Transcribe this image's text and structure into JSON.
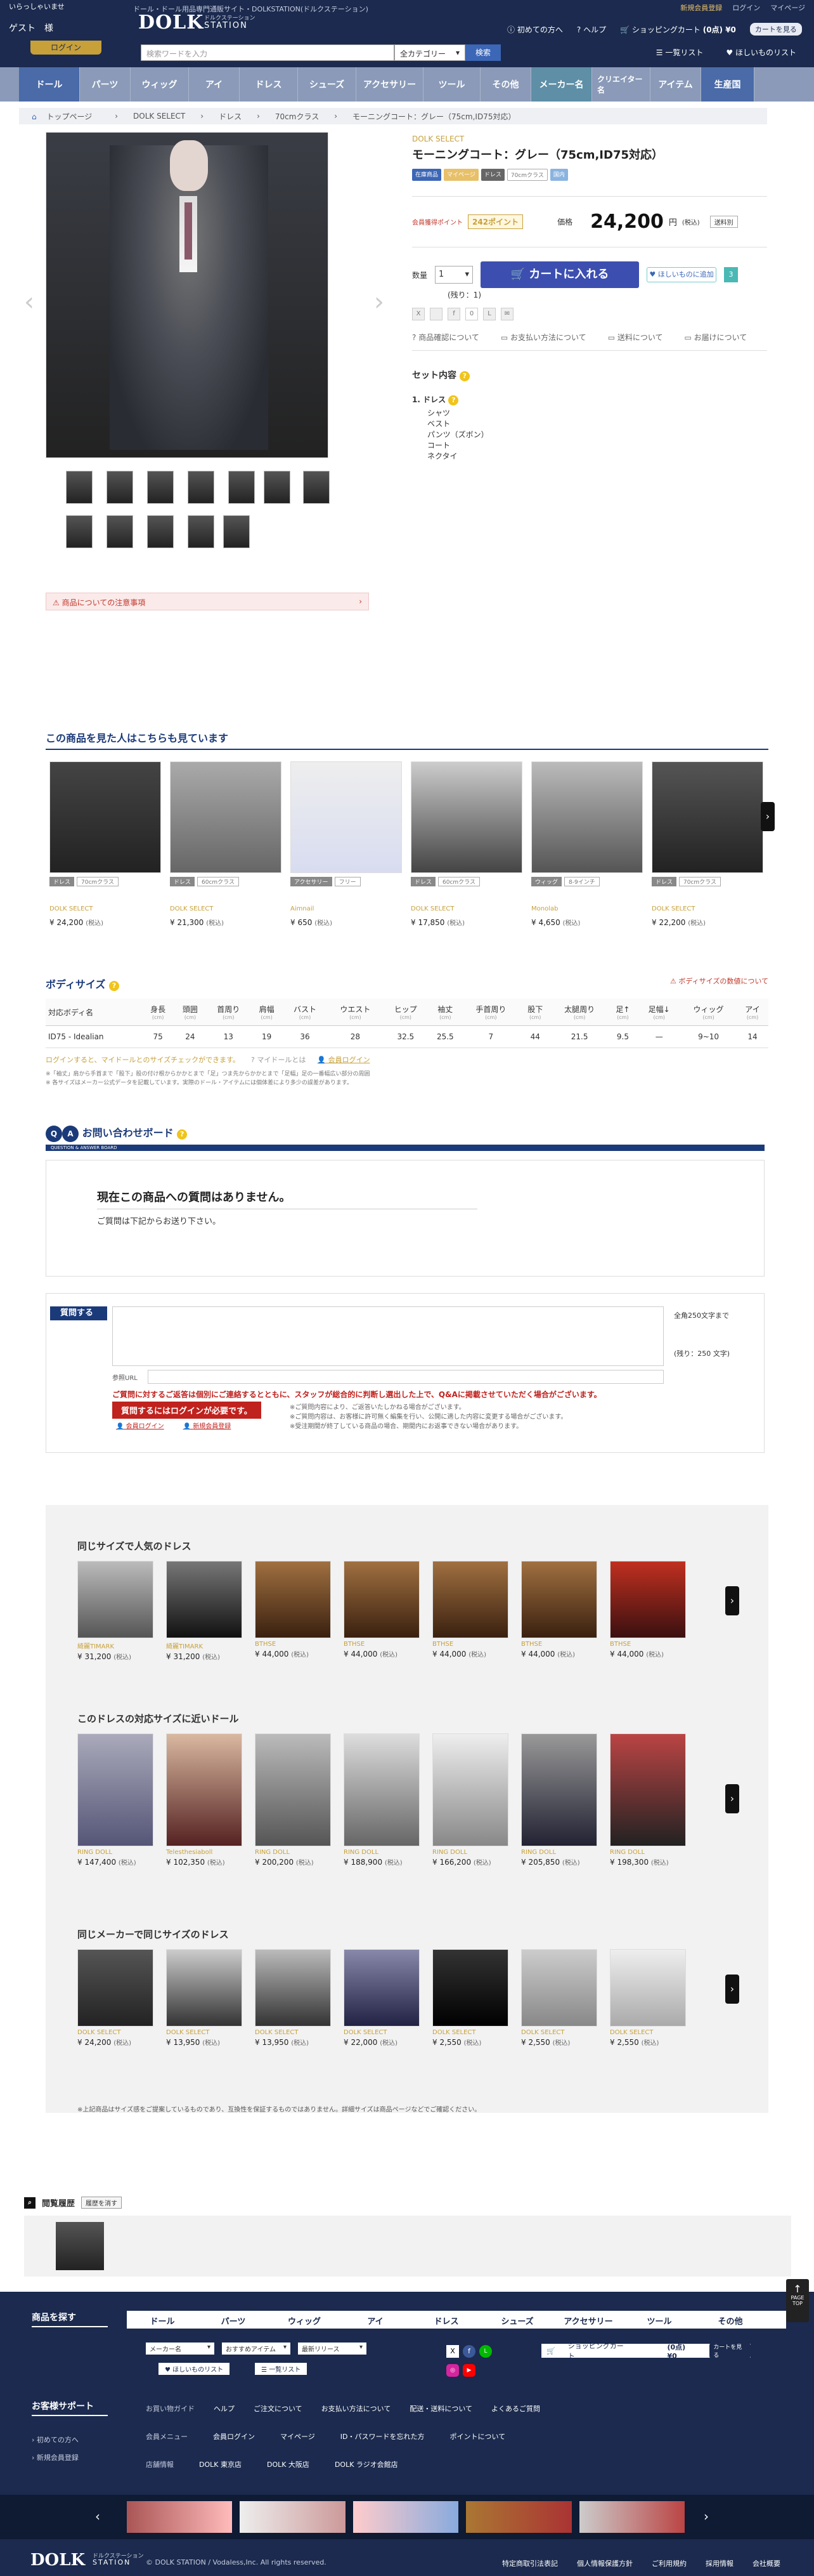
{
  "header": {
    "welcome": "いらっしゃいませ",
    "guest": "ゲスト　様",
    "login": "ログイン",
    "tagline": "ドール・ドール用品専門通販サイト・DOLKSTATION(ドルクステーション)",
    "logo": "DOLK",
    "logo_sub_top": "ドルクステーション",
    "logo_sub_bottom": "STATION",
    "toplinks": [
      "新規会員登録",
      "ログイン",
      "マイページ"
    ],
    "subbar": [
      "初めての方へ",
      "ヘルプ",
      "ショッピングカート",
      "(0点) ¥0"
    ],
    "cart_button": "カートを見る"
  },
  "search": {
    "placeholder": "検索ワードを入力",
    "category": "全カテゴリー",
    "button": "検索",
    "right": [
      "一覧リスト",
      "ほしいものリスト"
    ]
  },
  "nav": [
    "ドール",
    "パーツ",
    "ウィッグ",
    "アイ",
    "ドレス",
    "シューズ",
    "アクセサリー",
    "ツール",
    "その他",
    "メーカー名",
    "クリエイター名",
    "アイテム",
    "生産国"
  ],
  "breadcrumb": [
    "トップページ",
    "DOLK SELECT",
    "ドレス",
    "70cmクラス",
    "モーニングコート：グレー（75cm,ID75対応）"
  ],
  "product": {
    "maker": "DOLK SELECT",
    "title": "モーニングコート：グレー（75cm,ID75対応）",
    "tags": [
      "在庫商品",
      "マイページ",
      "ドレス",
      "70cmクラス",
      "国内"
    ],
    "points_label": "会員獲得ポイント",
    "points": "242ポイント",
    "price_label": "価格",
    "price": "24,200",
    "price_unit": "円",
    "tax": "(税込)",
    "postage": "送料別",
    "qty_label": "数量",
    "qty": "1",
    "remain": "(残り：1)",
    "cart": "カートに入れる",
    "wish": "ほしいものに追加",
    "wish_count": "3",
    "share_count": "0",
    "links": [
      "商品確認について",
      "お支払い方法について",
      "送料について",
      "お届けについて"
    ],
    "set_title": "セット内容",
    "set_group": "1. ドレス",
    "set_items": [
      "シャツ",
      "ベスト",
      "パンツ（ズボン）",
      "コート",
      "ネクタイ"
    ]
  },
  "notice": "商品についての注意事項",
  "also": {
    "title": "この商品を見た人はこちらも見ています",
    "items": [
      {
        "b1": "ドレス",
        "b2": "70cmクラス",
        "maker": "DOLK SELECT",
        "price": "¥ 24,200"
      },
      {
        "b1": "ドレス",
        "b2": "60cmクラス",
        "maker": "DOLK SELECT",
        "price": "¥ 21,300"
      },
      {
        "b1": "アクセサリー",
        "b2": "フリー",
        "maker": "Aimnail",
        "price": "¥ 650"
      },
      {
        "b1": "ドレス",
        "b2": "60cmクラス",
        "maker": "DOLK SELECT",
        "price": "¥ 17,850"
      },
      {
        "b1": "ウィッグ",
        "b2": "8-9インチ",
        "maker": "Monolab",
        "price": "¥ 4,650"
      },
      {
        "b1": "ドレス",
        "b2": "70cmクラス",
        "maker": "DOLK SELECT",
        "price": "¥ 22,200"
      }
    ],
    "tax": "(税込)"
  },
  "bodysize": {
    "title": "ボディサイズ",
    "warn": "ボディサイズの数値について",
    "headers": [
      "対応ボディ名",
      "身長",
      "頭囲",
      "首周り",
      "肩幅",
      "バスト",
      "ウエスト",
      "ヒップ",
      "袖丈",
      "手首周り",
      "股下",
      "太腿周り",
      "足↑",
      "足幅↓",
      "ウィッグ",
      "アイ"
    ],
    "unit": "(cm)",
    "row": [
      "ID75 - Idealian",
      "75",
      "24",
      "13",
      "19",
      "36",
      "28",
      "32.5",
      "25.5",
      "7",
      "44",
      "21.5",
      "9.5",
      "—",
      "9~10",
      "14"
    ],
    "login_note": "ログインすると、マイドールとのサイズチェックができます。",
    "mydoll": "マイドールとは",
    "login_link": "会員ログイン",
    "notes": [
      "※「袖丈」肩から手首まで「股下」股の付け根からかかとまで「足」つま先からかかとまで「足幅」足の一番幅広い部分の周囲",
      "※ 各サイズはメーカー公式データを記載しています。実際のドール・アイテムには個体差により多少の誤差があります。"
    ]
  },
  "qa": {
    "title": "お問い合わせボード",
    "banner": "QUESTION & ANSWER BOARD",
    "empty_title": "現在この商品への質問はありません。",
    "empty_sub": "ご質問は下記からお送り下さい。",
    "ask": "質問する",
    "limit": "全角250文字まで",
    "remain": "(残り：250 文字)",
    "nick": "参照URL",
    "warn_red": "ご質問に対するご返答は個別にご連絡するとともに、スタッフが総合的に判断し選出した上で、Q&Aに掲載させていただく場合がございます。",
    "login_required": "質問するにはログインが必要です。",
    "login_links": [
      "会員ログイン",
      "新規会員登録"
    ],
    "notes": [
      "※ご質問内容により、ご返答いたしかねる場合がございます。",
      "※ご質問内容は、お客様に許可無く編集を行い、公開に適した内容に変更する場合がございます。",
      "※受注期間が終了している商品の場合、期間内にお返事できない場合があります。"
    ]
  },
  "rec": {
    "sec1": "同じサイズで人気のドレス",
    "items1": [
      {
        "maker": "綺麗TIMARK",
        "price": "¥ 31,200"
      },
      {
        "maker": "綺麗TIMARK",
        "price": "¥ 31,200"
      },
      {
        "maker": "BTHSE",
        "price": "¥ 44,000"
      },
      {
        "maker": "BTHSE",
        "price": "¥ 44,000"
      },
      {
        "maker": "BTHSE",
        "price": "¥ 44,000"
      },
      {
        "maker": "BTHSE",
        "price": "¥ 44,000"
      },
      {
        "maker": "BTHSE",
        "price": "¥ 44,000"
      }
    ],
    "sec2": "このドレスの対応サイズに近いドール",
    "items2": [
      {
        "maker": "RING DOLL",
        "price": "¥ 147,400"
      },
      {
        "maker": "Telesthesiaboll",
        "price": "¥ 102,350"
      },
      {
        "maker": "RING DOLL",
        "price": "¥ 200,200"
      },
      {
        "maker": "RING DOLL",
        "price": "¥ 188,900"
      },
      {
        "maker": "RING DOLL",
        "price": "¥ 166,200"
      },
      {
        "maker": "RING DOLL",
        "price": "¥ 205,850"
      },
      {
        "maker": "RING DOLL",
        "price": "¥ 198,300"
      }
    ],
    "sec3": "同じメーカーで同じサイズのドレス",
    "items3": [
      {
        "maker": "DOLK SELECT",
        "price": "¥ 24,200"
      },
      {
        "maker": "DOLK SELECT",
        "price": "¥ 13,950"
      },
      {
        "maker": "DOLK SELECT",
        "price": "¥ 13,950"
      },
      {
        "maker": "DOLK SELECT",
        "price": "¥ 22,000"
      },
      {
        "maker": "DOLK SELECT",
        "price": "¥ 2,550"
      },
      {
        "maker": "DOLK SELECT",
        "price": "¥ 2,550"
      },
      {
        "maker": "DOLK SELECT",
        "price": "¥ 2,550"
      }
    ],
    "tax": "(税込)",
    "note": "※上記商品はサイズ感をご提案しているものであり、互換性を保証するものではありません。詳細サイズは商品ページなどでご確認ください。"
  },
  "history": {
    "title": "閲覧履歴",
    "clear": "履歴を消す"
  },
  "pagetop": "PAGE TOP",
  "footer": {
    "browse": "商品を探す",
    "nav": [
      "ドール",
      "パーツ",
      "ウィッグ",
      "アイ",
      "ドレス",
      "シューズ",
      "アクセサリー",
      "ツール",
      "その他"
    ],
    "selects": [
      "メーカー名",
      "おすすめアイテム",
      "最新リリース"
    ],
    "lists": [
      "ほしいものリスト",
      "一覧リスト"
    ],
    "cart": "ショッピングカート",
    "cart_count": "(0点) ¥0",
    "cart_btn": "カートを見る",
    "support": "お客様サポート",
    "side": [
      "初めての方へ",
      "新規会員登録"
    ],
    "guide_label": "お買い物ガイド",
    "guide": [
      "ヘルプ",
      "ご注文について",
      "お支払い方法について",
      "配送・送料について",
      "よくあるご質問"
    ],
    "member_label": "会員メニュー",
    "member": [
      "会員ログイン",
      "マイページ",
      "ID・パスワードを忘れた方",
      "ポイントについて"
    ],
    "store_label": "店舗情報",
    "store": [
      "DOLK 東京店",
      "DOLK 大阪店",
      "DOLK ラジオ会館店"
    ],
    "copy": "© DOLK STATION / Vodaless,Inc. All rights reserved.",
    "bottom": [
      "特定商取引法表記",
      "個人情報保護方針",
      "ご利用規約",
      "採用情報",
      "会社概要"
    ]
  },
  "colors": {
    "navy": "#1b2a4e",
    "gold": "#c7a03a",
    "blue": "#3c4fb0",
    "red": "#c0221e"
  }
}
